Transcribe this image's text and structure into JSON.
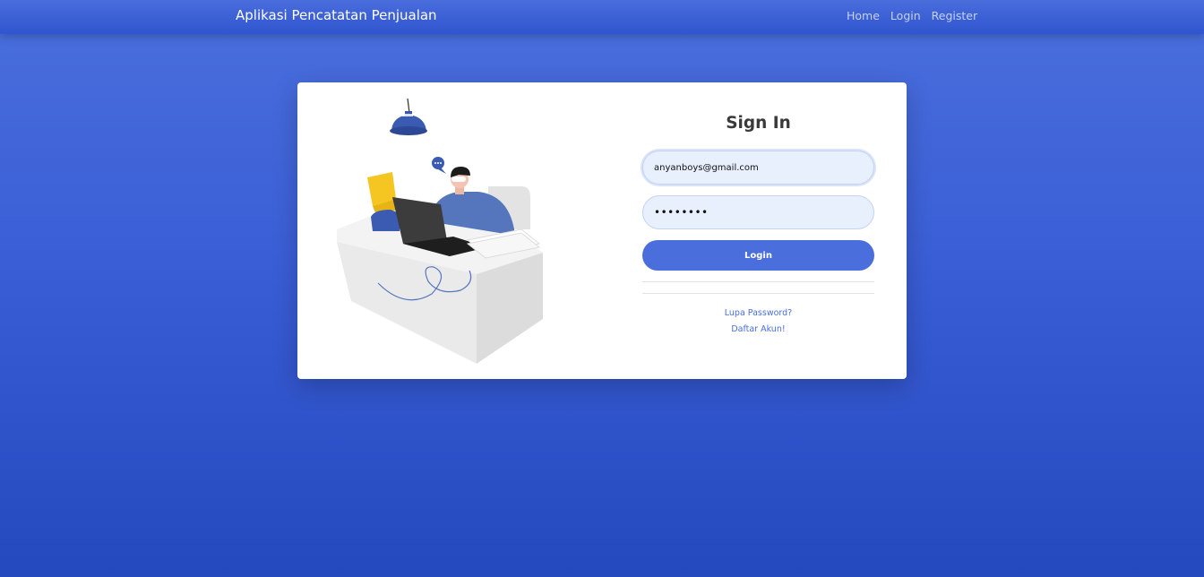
{
  "navbar": {
    "brand": "Aplikasi Pencatatan Penjualan",
    "links": [
      "Home",
      "Login",
      "Register"
    ]
  },
  "signin": {
    "title": "Sign In",
    "email_value": "anyanboys@gmail.com",
    "password_value": "••••••••",
    "login_label": "Login",
    "forgot_password": "Lupa Password?",
    "register_link": "Daftar Akun!"
  },
  "colors": {
    "primary": "#4a6fdc",
    "background_top": "#4a6fdc",
    "background_bottom": "#2448bd",
    "input_bg": "#e8f0fe"
  },
  "illustration": {
    "icon": "person-at-desk-illustration"
  }
}
